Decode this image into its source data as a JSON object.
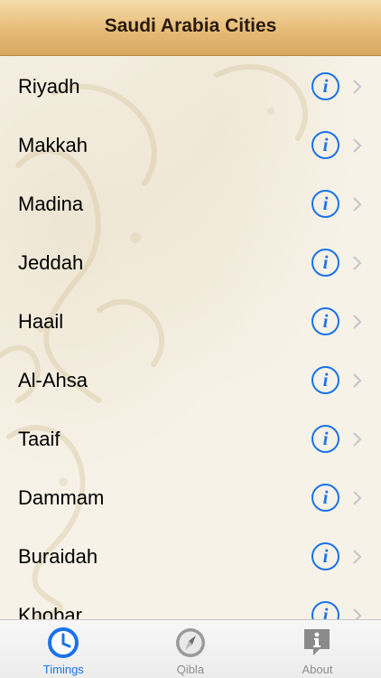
{
  "header": {
    "title": "Saudi Arabia Cities"
  },
  "cities": [
    {
      "name": "Riyadh"
    },
    {
      "name": "Makkah"
    },
    {
      "name": "Madina"
    },
    {
      "name": "Jeddah"
    },
    {
      "name": "Haail"
    },
    {
      "name": "Al-Ahsa"
    },
    {
      "name": "Taaif"
    },
    {
      "name": "Dammam"
    },
    {
      "name": "Buraidah"
    },
    {
      "name": "Khobar"
    }
  ],
  "info_glyph": "i",
  "tabs": [
    {
      "label": "Timings",
      "icon": "clock-icon",
      "active": true
    },
    {
      "label": "Qibla",
      "icon": "compass-icon",
      "active": false
    },
    {
      "label": "About",
      "icon": "info-speech-bubble-icon",
      "active": false
    }
  ],
  "colors": {
    "accent": "#1a73e8",
    "header_top": "#f5dba9",
    "header_bottom": "#d8a85f",
    "background": "#f7f2e7",
    "inactive_tab": "#8e8e8e"
  }
}
